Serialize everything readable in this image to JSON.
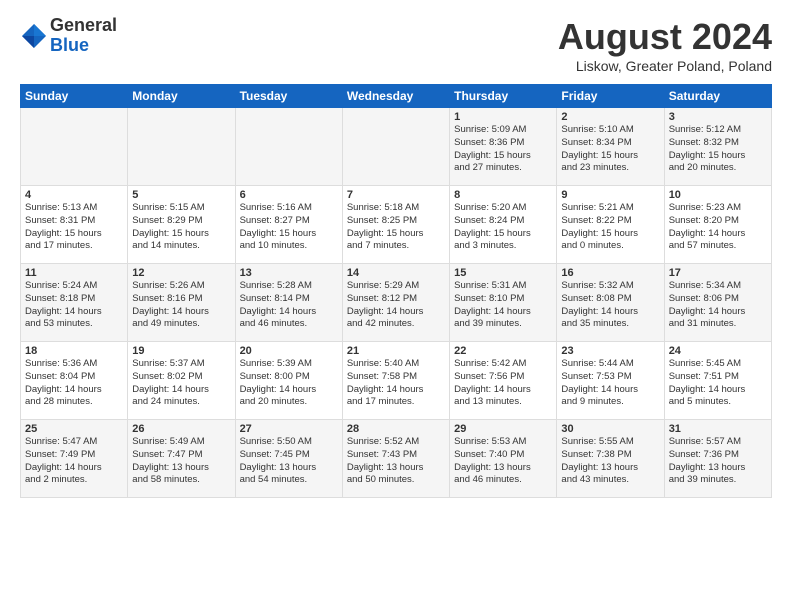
{
  "header": {
    "logo_general": "General",
    "logo_blue": "Blue",
    "month_title": "August 2024",
    "location": "Liskow, Greater Poland, Poland"
  },
  "days_of_week": [
    "Sunday",
    "Monday",
    "Tuesday",
    "Wednesday",
    "Thursday",
    "Friday",
    "Saturday"
  ],
  "weeks": [
    [
      {
        "day": "",
        "info": ""
      },
      {
        "day": "",
        "info": ""
      },
      {
        "day": "",
        "info": ""
      },
      {
        "day": "",
        "info": ""
      },
      {
        "day": "1",
        "info": "Sunrise: 5:09 AM\nSunset: 8:36 PM\nDaylight: 15 hours\nand 27 minutes."
      },
      {
        "day": "2",
        "info": "Sunrise: 5:10 AM\nSunset: 8:34 PM\nDaylight: 15 hours\nand 23 minutes."
      },
      {
        "day": "3",
        "info": "Sunrise: 5:12 AM\nSunset: 8:32 PM\nDaylight: 15 hours\nand 20 minutes."
      }
    ],
    [
      {
        "day": "4",
        "info": "Sunrise: 5:13 AM\nSunset: 8:31 PM\nDaylight: 15 hours\nand 17 minutes."
      },
      {
        "day": "5",
        "info": "Sunrise: 5:15 AM\nSunset: 8:29 PM\nDaylight: 15 hours\nand 14 minutes."
      },
      {
        "day": "6",
        "info": "Sunrise: 5:16 AM\nSunset: 8:27 PM\nDaylight: 15 hours\nand 10 minutes."
      },
      {
        "day": "7",
        "info": "Sunrise: 5:18 AM\nSunset: 8:25 PM\nDaylight: 15 hours\nand 7 minutes."
      },
      {
        "day": "8",
        "info": "Sunrise: 5:20 AM\nSunset: 8:24 PM\nDaylight: 15 hours\nand 3 minutes."
      },
      {
        "day": "9",
        "info": "Sunrise: 5:21 AM\nSunset: 8:22 PM\nDaylight: 15 hours\nand 0 minutes."
      },
      {
        "day": "10",
        "info": "Sunrise: 5:23 AM\nSunset: 8:20 PM\nDaylight: 14 hours\nand 57 minutes."
      }
    ],
    [
      {
        "day": "11",
        "info": "Sunrise: 5:24 AM\nSunset: 8:18 PM\nDaylight: 14 hours\nand 53 minutes."
      },
      {
        "day": "12",
        "info": "Sunrise: 5:26 AM\nSunset: 8:16 PM\nDaylight: 14 hours\nand 49 minutes."
      },
      {
        "day": "13",
        "info": "Sunrise: 5:28 AM\nSunset: 8:14 PM\nDaylight: 14 hours\nand 46 minutes."
      },
      {
        "day": "14",
        "info": "Sunrise: 5:29 AM\nSunset: 8:12 PM\nDaylight: 14 hours\nand 42 minutes."
      },
      {
        "day": "15",
        "info": "Sunrise: 5:31 AM\nSunset: 8:10 PM\nDaylight: 14 hours\nand 39 minutes."
      },
      {
        "day": "16",
        "info": "Sunrise: 5:32 AM\nSunset: 8:08 PM\nDaylight: 14 hours\nand 35 minutes."
      },
      {
        "day": "17",
        "info": "Sunrise: 5:34 AM\nSunset: 8:06 PM\nDaylight: 14 hours\nand 31 minutes."
      }
    ],
    [
      {
        "day": "18",
        "info": "Sunrise: 5:36 AM\nSunset: 8:04 PM\nDaylight: 14 hours\nand 28 minutes."
      },
      {
        "day": "19",
        "info": "Sunrise: 5:37 AM\nSunset: 8:02 PM\nDaylight: 14 hours\nand 24 minutes."
      },
      {
        "day": "20",
        "info": "Sunrise: 5:39 AM\nSunset: 8:00 PM\nDaylight: 14 hours\nand 20 minutes."
      },
      {
        "day": "21",
        "info": "Sunrise: 5:40 AM\nSunset: 7:58 PM\nDaylight: 14 hours\nand 17 minutes."
      },
      {
        "day": "22",
        "info": "Sunrise: 5:42 AM\nSunset: 7:56 PM\nDaylight: 14 hours\nand 13 minutes."
      },
      {
        "day": "23",
        "info": "Sunrise: 5:44 AM\nSunset: 7:53 PM\nDaylight: 14 hours\nand 9 minutes."
      },
      {
        "day": "24",
        "info": "Sunrise: 5:45 AM\nSunset: 7:51 PM\nDaylight: 14 hours\nand 5 minutes."
      }
    ],
    [
      {
        "day": "25",
        "info": "Sunrise: 5:47 AM\nSunset: 7:49 PM\nDaylight: 14 hours\nand 2 minutes."
      },
      {
        "day": "26",
        "info": "Sunrise: 5:49 AM\nSunset: 7:47 PM\nDaylight: 13 hours\nand 58 minutes."
      },
      {
        "day": "27",
        "info": "Sunrise: 5:50 AM\nSunset: 7:45 PM\nDaylight: 13 hours\nand 54 minutes."
      },
      {
        "day": "28",
        "info": "Sunrise: 5:52 AM\nSunset: 7:43 PM\nDaylight: 13 hours\nand 50 minutes."
      },
      {
        "day": "29",
        "info": "Sunrise: 5:53 AM\nSunset: 7:40 PM\nDaylight: 13 hours\nand 46 minutes."
      },
      {
        "day": "30",
        "info": "Sunrise: 5:55 AM\nSunset: 7:38 PM\nDaylight: 13 hours\nand 43 minutes."
      },
      {
        "day": "31",
        "info": "Sunrise: 5:57 AM\nSunset: 7:36 PM\nDaylight: 13 hours\nand 39 minutes."
      }
    ]
  ]
}
